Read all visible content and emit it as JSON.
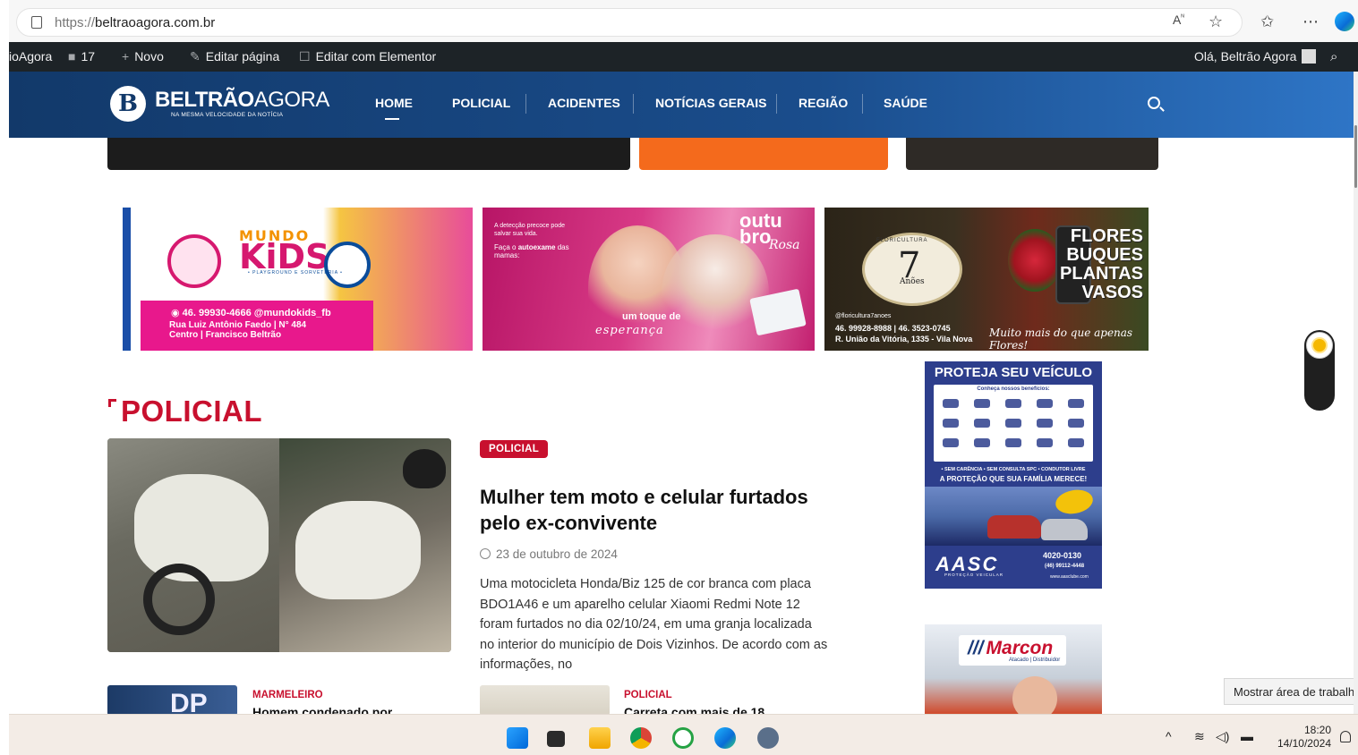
{
  "browser": {
    "url_proto": "https://",
    "url_host": "beltraoagora.com.br",
    "icons": [
      "read-aloud-icon",
      "favorite-star-icon",
      "favorites-list-icon",
      "more-icon",
      "copilot-icon"
    ]
  },
  "adminbar": {
    "site": "ioAgora",
    "comments_count": "17",
    "new": "Novo",
    "edit_page": "Editar página",
    "elementor": "Editar com Elementor",
    "greeting": "Olá, Beltrão Agora"
  },
  "header": {
    "logo_name_bold": "BELTRÃO",
    "logo_name_thin": "AGORA",
    "logo_tagline": "NA MESMA VELOCIDADE DA NOTÍCIA",
    "nav": [
      "HOME",
      "POLICIAL",
      "ACIDENTES",
      "NOTÍCIAS GERAIS",
      "REGIÃO",
      "SAÚDE"
    ]
  },
  "banners": {
    "mundo_kids": {
      "word_top": "MUNDO",
      "word_main": "KiDS",
      "subtitle": "• PLAYGROUND E SORVETERIA •",
      "phone": "46. 99930-4666  @mundokids_fb",
      "address_1": "Rua Luiz Antônio Faedo | N° 484",
      "address_2": "Centro | Francisco Beltrão"
    },
    "outubro": {
      "line1": "A detecção precoce pode salvar sua vida.",
      "line2_pre": "Faça o ",
      "line2_bold": "autoexame",
      "line2_post": " das mamas:",
      "brand_1": "outu",
      "brand_2": "bro",
      "brand_3": "Rosa",
      "tagline_1": "um toque de",
      "tagline_2": "esperança"
    },
    "floricultura": {
      "header": "FLORICULTURA",
      "number": "7",
      "name": "Anões",
      "words": [
        "FLORES",
        "BUQUES",
        "PLANTAS",
        "VASOS"
      ],
      "instagram": "@floricultura7anoes",
      "phones": "46. 99928-8988 | 46. 3523-0745",
      "address": "R. União da Vitória, 1335 - Vila Nova",
      "slogan": "Muito mais do que apenas Flores!"
    }
  },
  "section": {
    "title": "POLICIAL"
  },
  "featured": {
    "category": "POLICIAL",
    "title": "Mulher tem moto e celular furtados pelo ex-convivente",
    "date": "23 de outubro de 2024",
    "excerpt": "Uma motocicleta Honda/Biz 125 de cor branca com placa BDO1A46 e um aparelho celular Xiaomi Redmi Note 12 foram furtados no dia 02/10/24, em uma granja localizada no interior do município de Dois Vizinhos. De acordo com as informações, no"
  },
  "small_items": [
    {
      "category": "MARMELEIRO",
      "title": "Homem condenado por"
    },
    {
      "category": "POLICIAL",
      "title": "Carreta com mais de 18"
    }
  ],
  "ads": {
    "aasc": {
      "headline": "PROTEJA SEU VEÍCULO",
      "benefits": "Conheça nossos benefícios:",
      "line1": "• SEM CARÊNCIA • SEM CONSULTA SPC • CONDUTOR LIVRE",
      "line2": "A PROTEÇÃO QUE SUA FAMÍLIA MERECE!",
      "brand": "AASC",
      "sub": "PROTEÇÃO VEICULAR",
      "phone": "4020-0130",
      "whats": "(46) 99112-4448",
      "site": "www.aasclube.com"
    },
    "marcon": {
      "brand": "Marcon",
      "sub": "Atacado | Distribuidor"
    }
  },
  "tooltip": "Mostrar área de trabalho",
  "taskbar": {
    "apps": [
      "windows-start-icon",
      "task-view-icon",
      "file-explorer-icon",
      "chrome-icon",
      "whatsapp-icon",
      "edge-icon",
      "settings-icon"
    ],
    "time": "18:20",
    "date": "14/10/2024"
  }
}
